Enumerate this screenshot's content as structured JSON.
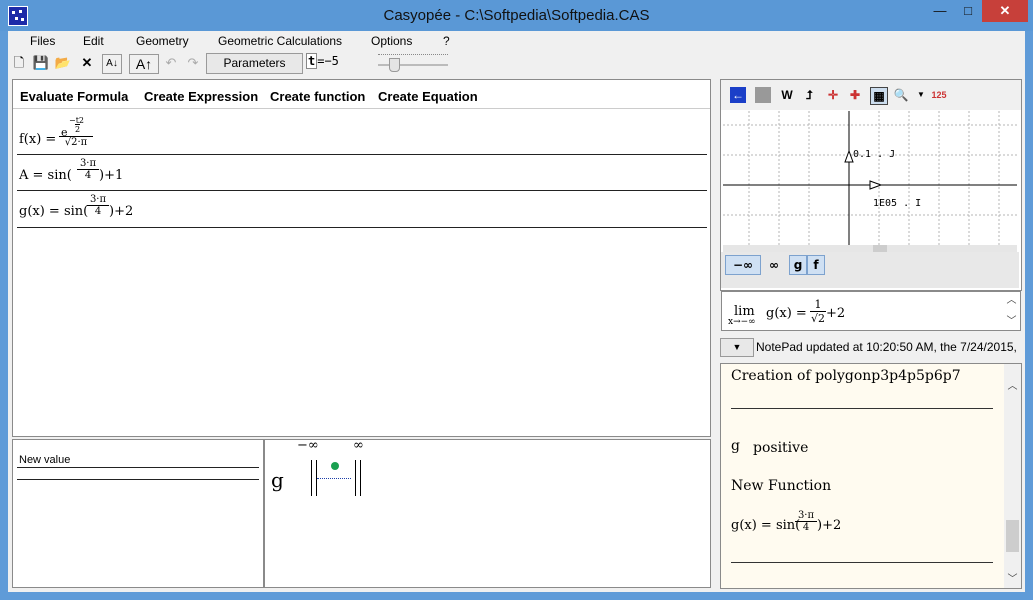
{
  "window": {
    "title": "Casyopée - C:\\Softpedia\\Softpedia.CAS",
    "min": "—",
    "max": "□",
    "close": "✕"
  },
  "menu": [
    "Files",
    "Edit",
    "Geometry",
    "Geometric Calculations",
    "Options",
    "?"
  ],
  "toolbar": {
    "parameters_label": "Parameters",
    "t_label": "t",
    "t_value": "=−5"
  },
  "commands": [
    "Evaluate Formula",
    "Create Expression",
    "Create function",
    "Create Equation"
  ],
  "expressions": [
    {
      "lhs": "f(x) = ",
      "numer_exp": "−t2",
      "numer_exp2": "2",
      "numer_base": "e",
      "denom": "√2·π"
    },
    {
      "lhs": "A = sin(",
      "frac_num": "3·π",
      "frac_den": "4",
      "rhs": ")+1"
    },
    {
      "lhs": "g(x) = sin(",
      "frac_num": "3·π",
      "frac_den": "4",
      "rhs": ")+2"
    }
  ],
  "new_value_label": "New value",
  "variation": {
    "func": "g",
    "left": "−∞",
    "right": "∞"
  },
  "graph": {
    "toolbar": [
      "W"
    ],
    "y_label": "0.1 . J",
    "x_label": "1E05 . I",
    "buttons": [
      "−∞",
      "∞",
      "g",
      "f"
    ]
  },
  "limit": {
    "lim": "lim",
    "sub": "x→−∞",
    "expr": "g(x) = ",
    "num": "1",
    "den": "√2",
    "rest": "+2"
  },
  "status": "NotePad updated at 10:20:50 AM, the 7/24/2015,",
  "notepad": {
    "item1": "Creation of polygonp3p4p5p6p7",
    "item2_func": "g",
    "item2_text": "positive",
    "item3": "New Function",
    "item4_lhs": "g(x) = sin(",
    "item4_num": "3·π",
    "item4_den": "4",
    "item4_rhs": ")+2"
  },
  "colors": {
    "accent": "#5f9bd8",
    "close": "#c7403a",
    "note_bg": "#fffbf0",
    "point": "#1aa050"
  }
}
